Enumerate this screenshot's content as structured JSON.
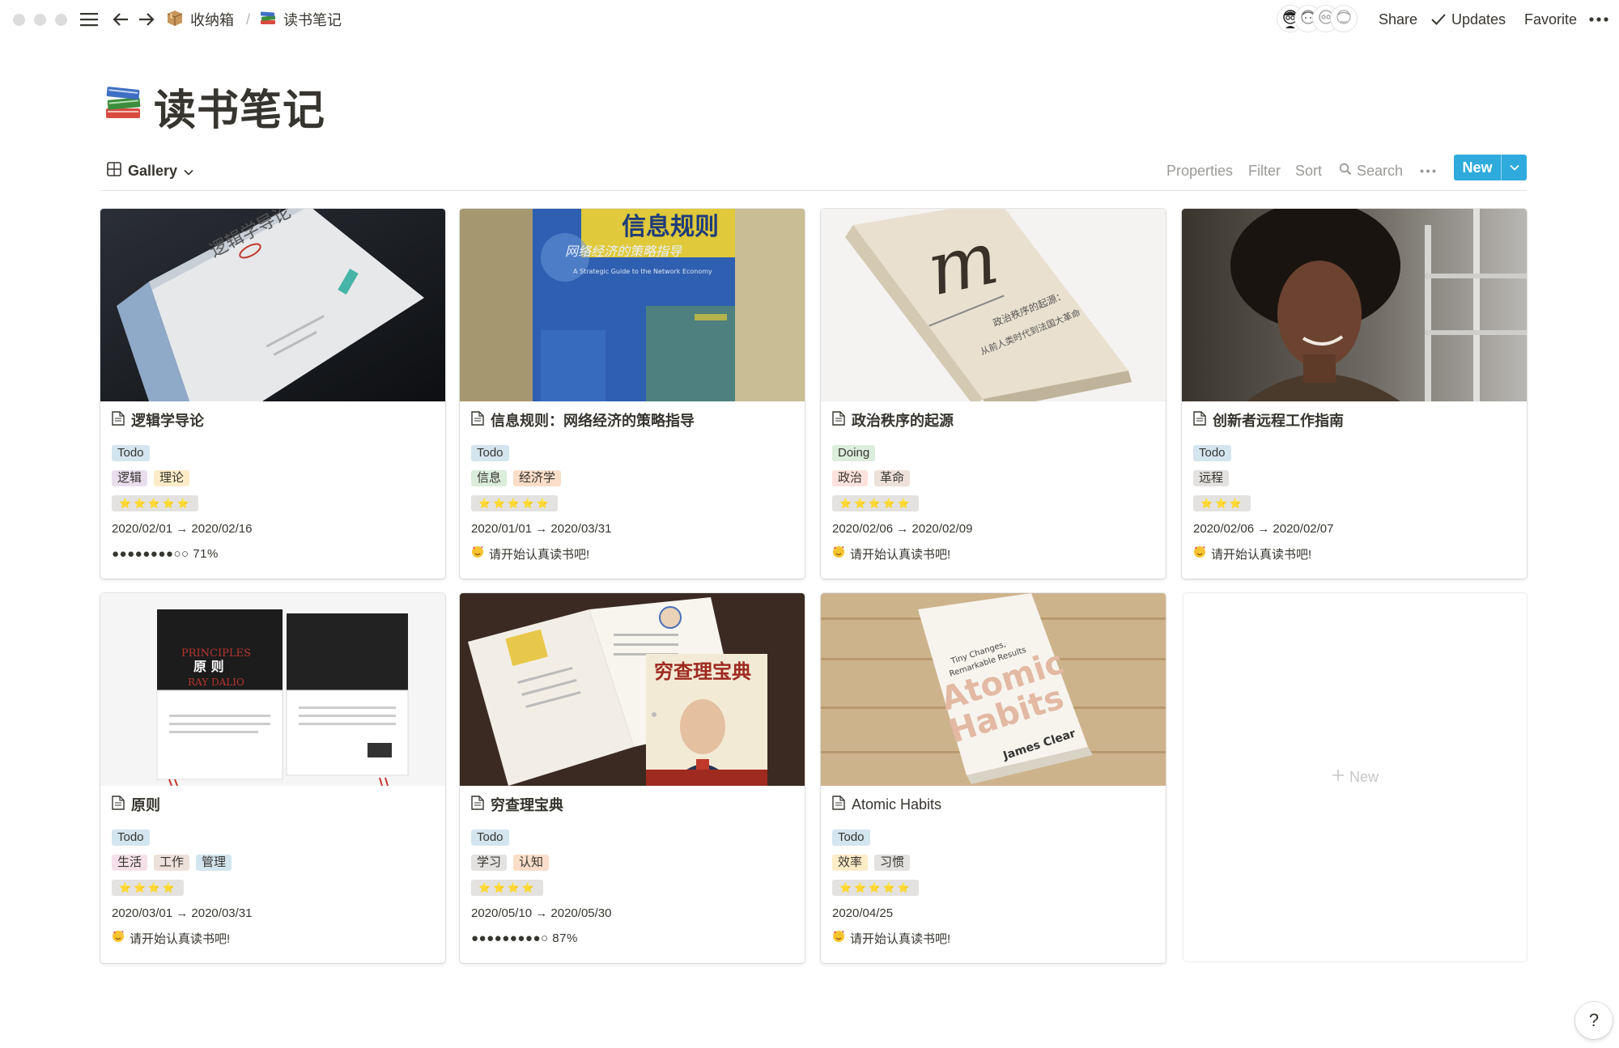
{
  "breadcrumb": [
    {
      "label": "收纳箱",
      "icon": "package-icon"
    },
    {
      "label": "读书笔记",
      "icon": "books-icon"
    }
  ],
  "header": {
    "share_label": "Share",
    "updates_label": "Updates",
    "favorite_label": "Favorite"
  },
  "page": {
    "title": "读书笔记",
    "icon": "books-icon"
  },
  "view": {
    "name": "Gallery",
    "properties_label": "Properties",
    "filter_label": "Filter",
    "sort_label": "Sort",
    "search_label": "Search",
    "new_label": "New"
  },
  "cards": [
    {
      "title": "逻辑学导论",
      "status": "Todo",
      "tags": [
        {
          "label": "逻辑",
          "color": "purple"
        },
        {
          "label": "理论",
          "color": "yellow"
        }
      ],
      "stars": "⭐⭐⭐⭐⭐",
      "date": "2020/02/01 → 2020/02/16",
      "progress": "●●●●●●●●○○ 71%",
      "progress_value": 0.71
    },
    {
      "title": "信息规则：网络经济的策略指导",
      "status": "Todo",
      "tags": [
        {
          "label": "信息",
          "color": "green"
        },
        {
          "label": "经济学",
          "color": "orange"
        }
      ],
      "stars": "⭐⭐⭐⭐⭐",
      "date": "2020/01/01 → 2020/03/31",
      "note": "请开始认真读书吧!"
    },
    {
      "title": "政治秩序的起源",
      "status": "Doing",
      "tags": [
        {
          "label": "政治",
          "color": "red"
        },
        {
          "label": "革命",
          "color": "brown"
        }
      ],
      "stars": "⭐⭐⭐⭐⭐",
      "date": "2020/02/06 → 2020/02/09",
      "note": "请开始认真读书吧!"
    },
    {
      "title": "创新者远程工作指南",
      "status": "Todo",
      "tags": [
        {
          "label": "远程",
          "color": "gray"
        }
      ],
      "stars": "⭐⭐⭐",
      "date": "2020/02/06 → 2020/02/07",
      "note": "请开始认真读书吧!"
    },
    {
      "title": "原则",
      "status": "Todo",
      "tags": [
        {
          "label": "生活",
          "color": "pink"
        },
        {
          "label": "工作",
          "color": "brown"
        },
        {
          "label": "管理",
          "color": "blue"
        }
      ],
      "stars": "⭐⭐⭐⭐",
      "date": "2020/03/01 → 2020/03/31",
      "note": "请开始认真读书吧!"
    },
    {
      "title": "穷查理宝典",
      "status": "Todo",
      "tags": [
        {
          "label": "学习",
          "color": "gray"
        },
        {
          "label": "认知",
          "color": "orange"
        }
      ],
      "stars": "⭐⭐⭐⭐",
      "date": "2020/05/10 → 2020/05/30",
      "progress": "●●●●●●●●●○ 87%",
      "progress_value": 0.87
    },
    {
      "title": "Atomic Habits",
      "status": "Todo",
      "tags": [
        {
          "label": "效率",
          "color": "yellow"
        },
        {
          "label": "习惯",
          "color": "gray"
        }
      ],
      "stars": "⭐⭐⭐⭐⭐",
      "date": "2020/04/25",
      "note": "请开始认真读书吧!"
    }
  ],
  "covers": {
    "logic": {
      "title_cn": "逻辑学导论"
    },
    "info": {
      "title_cn": "信息规则",
      "subtitle_cn": "网络经济的策略指导",
      "subtitle_en": "A Strategic Guide to the Network Economy"
    },
    "political": {
      "letter": "m",
      "title_cn": "政治秩序的起源：",
      "subtitle_cn": "从前人类时代到法国大革命"
    },
    "principles": {
      "title_en": "PRINCIPLES",
      "title_cn": "原  则",
      "author": "RAY DALIO"
    },
    "charlie": {
      "title_cn": "穷查理宝典"
    },
    "atomic": {
      "line1": "Tiny Changes,",
      "line2": "Remarkable Results",
      "title1": "Atomic",
      "title2": "Habits",
      "author": "James Clear"
    }
  },
  "new_card_label": "New",
  "help_label": "?",
  "colors": {
    "accent": "#2eaadc",
    "text": "#37352f",
    "muted": "#9b9a97"
  }
}
